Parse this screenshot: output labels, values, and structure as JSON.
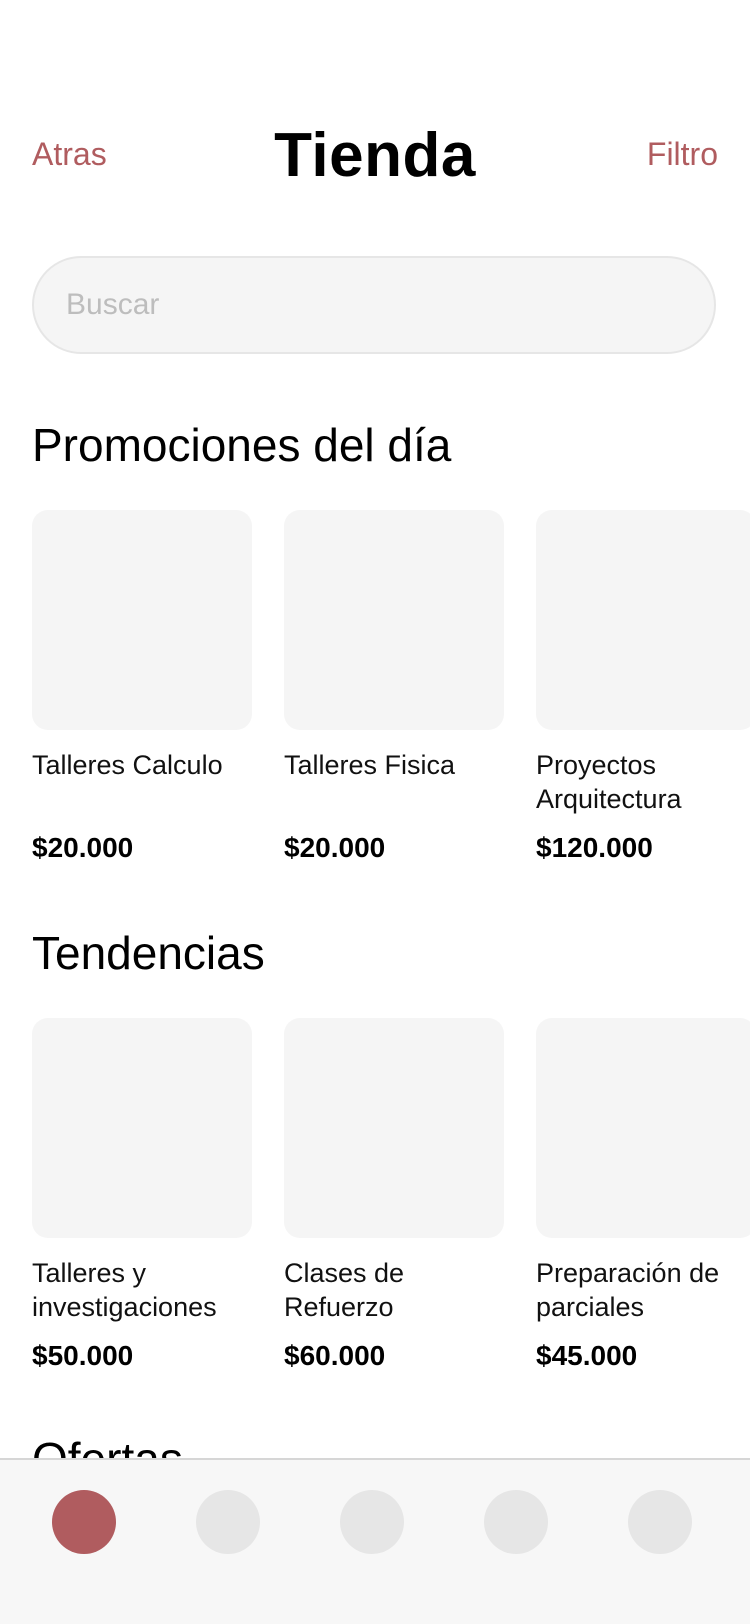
{
  "header": {
    "back_label": "Atras",
    "title": "Tienda",
    "filter_label": "Filtro"
  },
  "search": {
    "placeholder": "Buscar",
    "value": ""
  },
  "sections": [
    {
      "title": "Promociones del día",
      "items": [
        {
          "name": "Talleres Calculo",
          "price": "$20.000"
        },
        {
          "name": "Talleres Fisica",
          "price": "$20.000"
        },
        {
          "name": "Proyectos Arquitectura",
          "price": "$120.000"
        }
      ]
    },
    {
      "title": "Tendencias",
      "items": [
        {
          "name": "Talleres y investigaciones",
          "price": "$50.000"
        },
        {
          "name": "Clases de Refuerzo",
          "price": "$60.000"
        },
        {
          "name": "Preparación de parciales",
          "price": "$45.000"
        }
      ]
    },
    {
      "title": "Ofertas"
    }
  ],
  "tabbar": {
    "active_index": 0,
    "tabs": [
      "tab-1",
      "tab-2",
      "tab-3",
      "tab-4",
      "tab-5"
    ]
  },
  "colors": {
    "accent": "#b05c5f",
    "placeholder_bg": "#f5f5f5",
    "tab_inactive": "#e6e6e6"
  }
}
